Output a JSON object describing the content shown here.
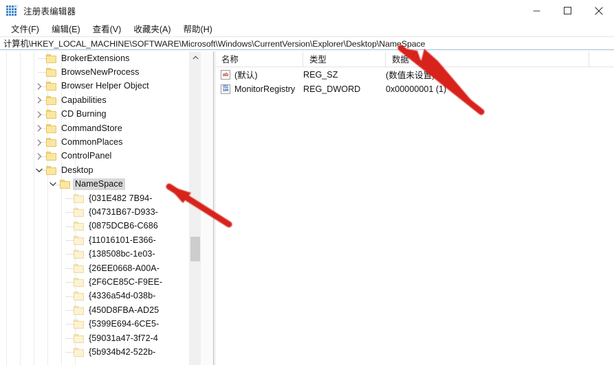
{
  "window": {
    "title": "注册表编辑器",
    "icon": "registry-editor-icon",
    "minimize_label": "—",
    "maximize_label": "□",
    "close_label": "✕"
  },
  "menu": {
    "items": [
      {
        "label": "文件(F)"
      },
      {
        "label": "编辑(E)"
      },
      {
        "label": "查看(V)"
      },
      {
        "label": "收藏夹(A)"
      },
      {
        "label": "帮助(H)"
      }
    ]
  },
  "address": {
    "path": "计算机\\HKEY_LOCAL_MACHINE\\SOFTWARE\\Microsoft\\Windows\\CurrentVersion\\Explorer\\Desktop\\NameSpace"
  },
  "tree": {
    "items": [
      {
        "label": "BrokerExtensions",
        "indent": 3,
        "expander": "none",
        "selected": false
      },
      {
        "label": "BrowseNewProcess",
        "indent": 3,
        "expander": "none",
        "selected": false
      },
      {
        "label": "Browser Helper Object",
        "indent": 3,
        "expander": "collapsed",
        "selected": false
      },
      {
        "label": "Capabilities",
        "indent": 3,
        "expander": "collapsed",
        "selected": false
      },
      {
        "label": "CD Burning",
        "indent": 3,
        "expander": "collapsed",
        "selected": false
      },
      {
        "label": "CommandStore",
        "indent": 3,
        "expander": "collapsed",
        "selected": false
      },
      {
        "label": "CommonPlaces",
        "indent": 3,
        "expander": "collapsed",
        "selected": false
      },
      {
        "label": "ControlPanel",
        "indent": 3,
        "expander": "collapsed",
        "selected": false
      },
      {
        "label": "Desktop",
        "indent": 3,
        "expander": "expanded",
        "selected": false
      },
      {
        "label": "NameSpace",
        "indent": 4,
        "expander": "expanded",
        "selected": true
      },
      {
        "label": "{031E482",
        "indent": 5,
        "expander": "none",
        "selected": false,
        "suffix": "7B94-"
      },
      {
        "label": "{04731B67-D933-",
        "indent": 5,
        "expander": "none",
        "selected": false
      },
      {
        "label": "{0875DCB6-C686",
        "indent": 5,
        "expander": "none",
        "selected": false
      },
      {
        "label": "{11016101-E366-",
        "indent": 5,
        "expander": "none",
        "selected": false
      },
      {
        "label": "{138508bc-1e03-",
        "indent": 5,
        "expander": "none",
        "selected": false
      },
      {
        "label": "{26EE0668-A00A-",
        "indent": 5,
        "expander": "none",
        "selected": false
      },
      {
        "label": "{2F6CE85C-F9EE-",
        "indent": 5,
        "expander": "none",
        "selected": false
      },
      {
        "label": "{4336a54d-038b-",
        "indent": 5,
        "expander": "none",
        "selected": false
      },
      {
        "label": "{450D8FBA-AD25",
        "indent": 5,
        "expander": "none",
        "selected": false
      },
      {
        "label": "{5399E694-6CE5-",
        "indent": 5,
        "expander": "none",
        "selected": false
      },
      {
        "label": "{59031a47-3f72-4",
        "indent": 5,
        "expander": "none",
        "selected": false
      },
      {
        "label": "{5b934b42-522b-",
        "indent": 5,
        "expander": "none",
        "selected": false
      }
    ]
  },
  "list": {
    "columns": [
      {
        "label": "名称"
      },
      {
        "label": "类型"
      },
      {
        "label": "数据"
      }
    ],
    "rows": [
      {
        "icon": "string-value-icon",
        "name": "(默认)",
        "type": "REG_SZ",
        "data": "(数值未设置)"
      },
      {
        "icon": "dword-value-icon",
        "name": "MonitorRegistry",
        "type": "REG_DWORD",
        "data": "0x00000001 (1)"
      }
    ]
  },
  "annotations": {
    "arrow_color": "#d8221c",
    "arrows": [
      {
        "name": "arrow-to-address-path"
      },
      {
        "name": "arrow-to-namespace-key"
      }
    ]
  }
}
